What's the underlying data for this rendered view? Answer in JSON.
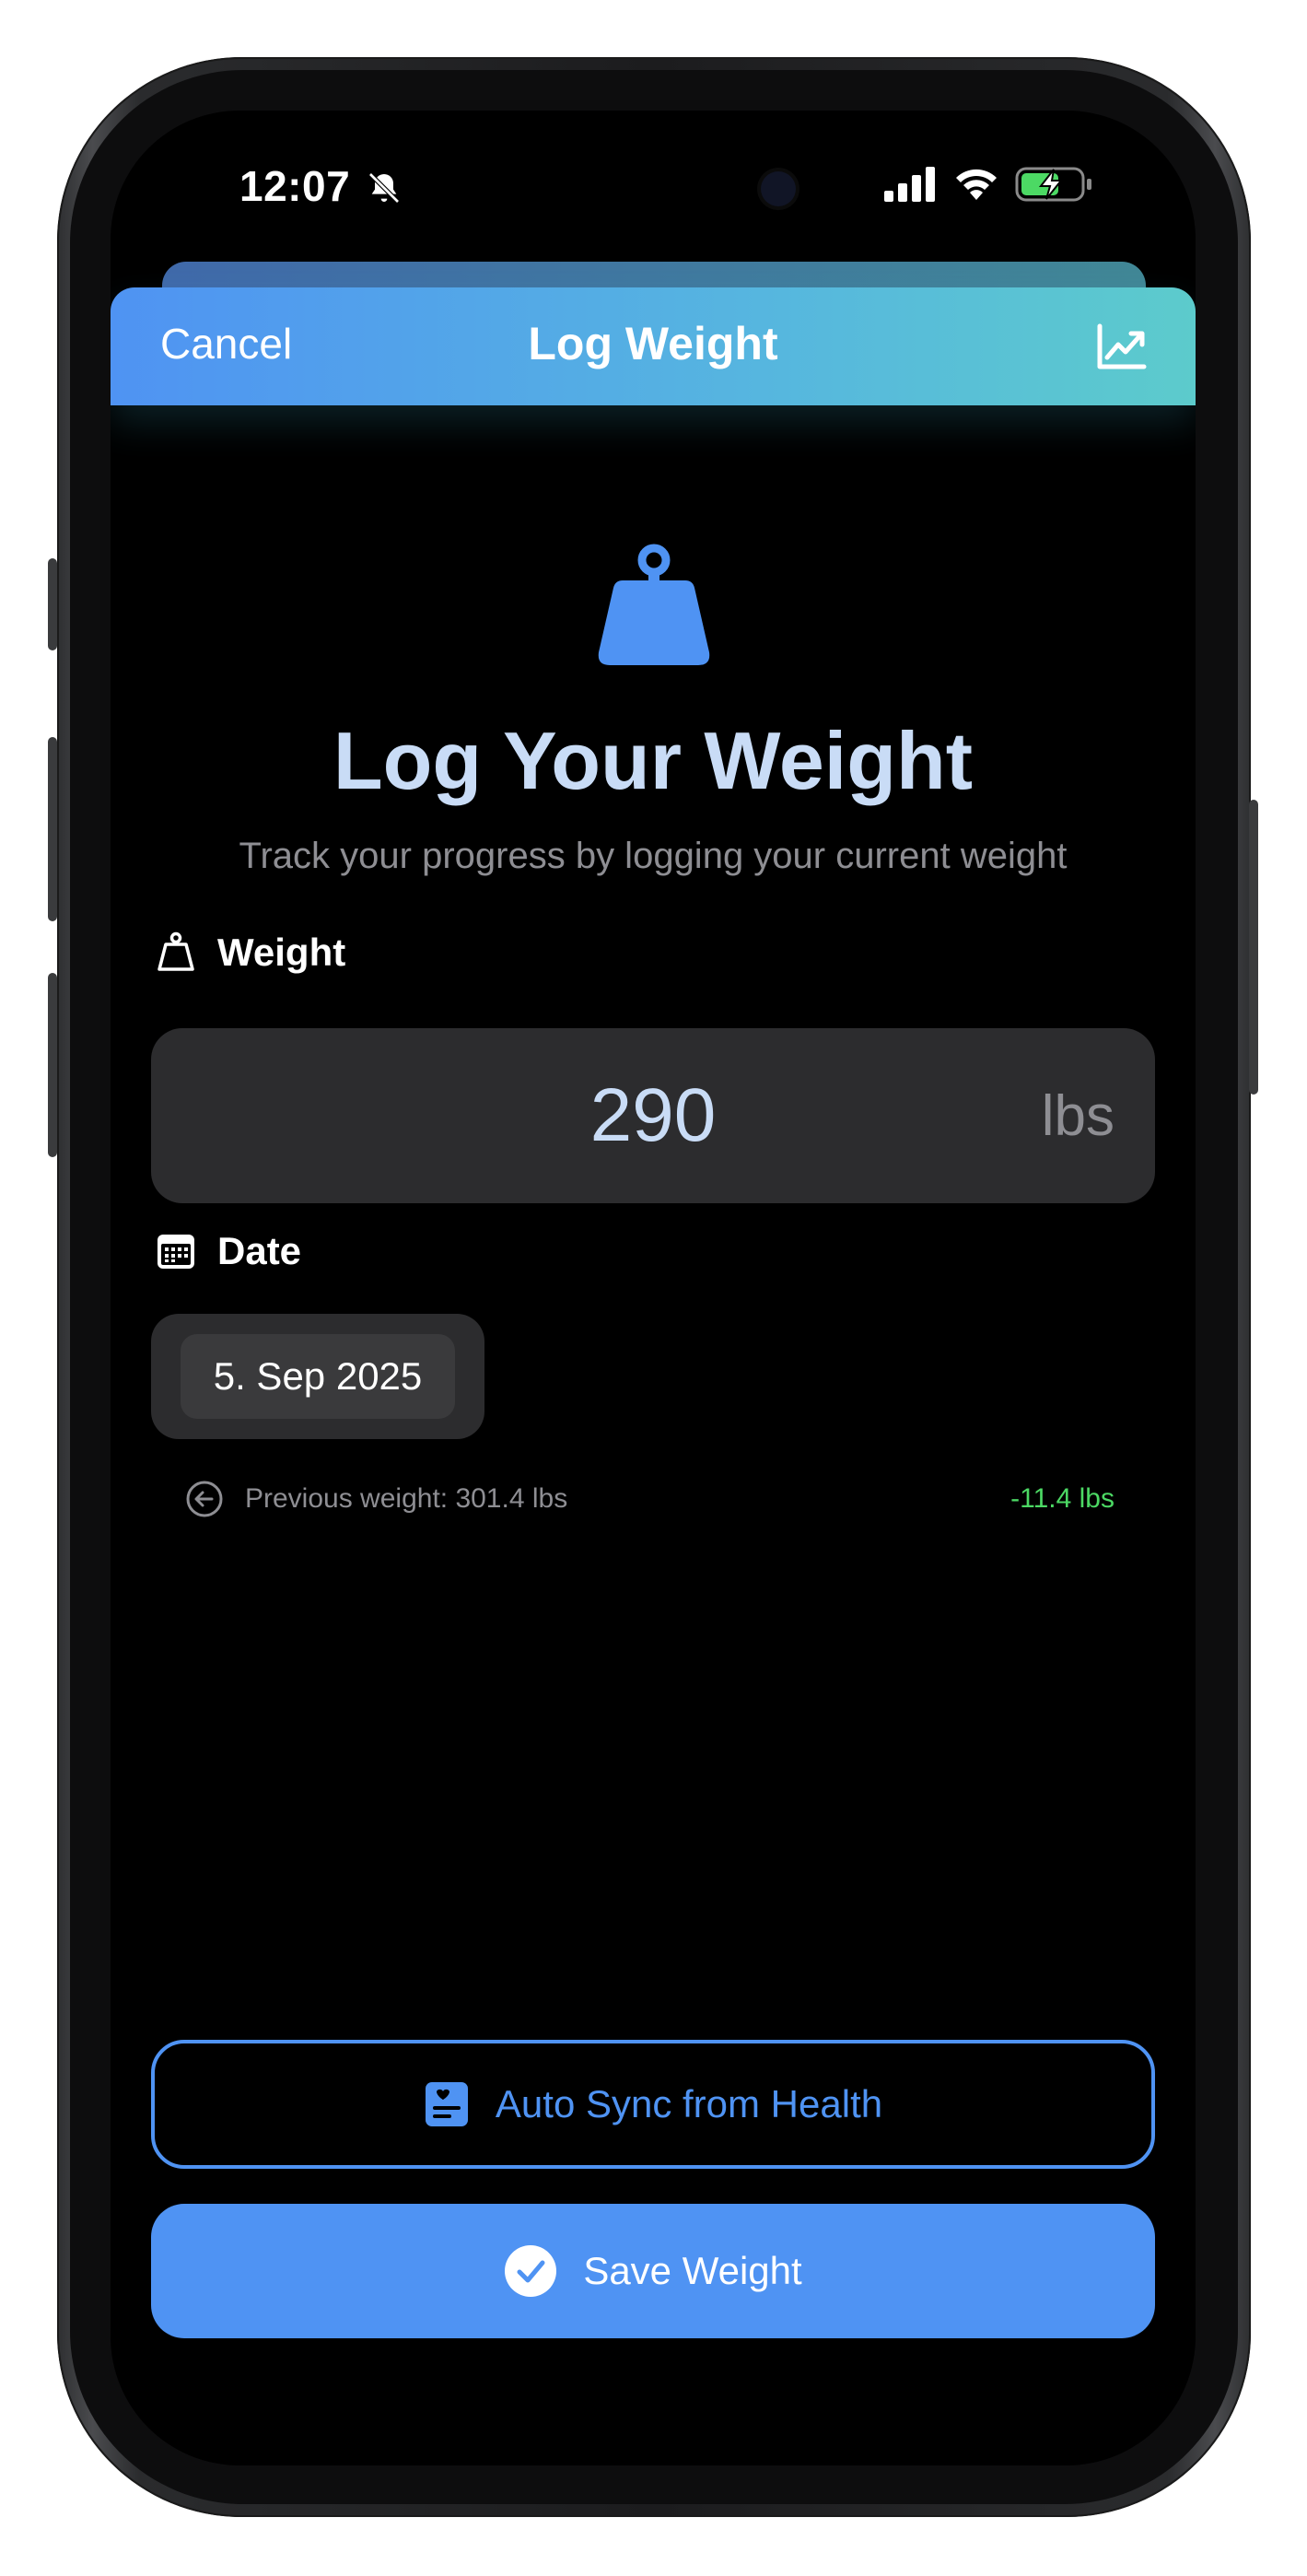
{
  "status_bar": {
    "time": "12:07"
  },
  "header": {
    "cancel_label": "Cancel",
    "title": "Log Weight"
  },
  "hero": {
    "title": "Log Your Weight",
    "subtitle": "Track your progress by logging your current weight"
  },
  "weight": {
    "label": "Weight",
    "value": "290",
    "unit": "lbs"
  },
  "date": {
    "label": "Date",
    "value": "5. Sep 2025"
  },
  "previous": {
    "text": "Previous weight: 301.4 lbs",
    "difference": "-11.4 lbs"
  },
  "actions": {
    "sync_label": "Auto Sync from Health",
    "save_label": "Save Weight"
  },
  "colors": {
    "accent": "#4f93f3",
    "header_gradient_start": "#4f93f3",
    "header_gradient_end": "#5ccbcc",
    "positive_change": "#4cd964",
    "title_text": "#c9dcf6"
  },
  "icons": {
    "header_right": "chart-line-uptrend-icon",
    "hero": "scale-mass-icon",
    "weight_label": "scale-mass-outline-icon",
    "date_label": "calendar-icon",
    "previous": "arrow-left-circle-icon",
    "sync": "health-record-icon",
    "save": "checkmark-circle-icon"
  }
}
